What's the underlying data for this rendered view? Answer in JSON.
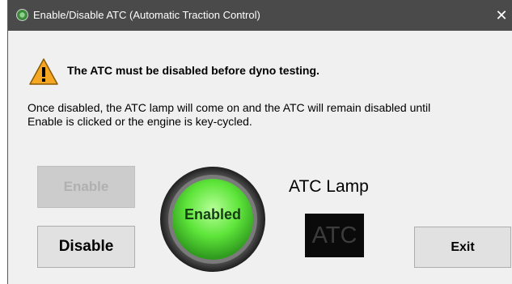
{
  "window": {
    "title": "Enable/Disable ATC  (Automatic Traction Control)",
    "icon": "app-icon",
    "close_label": "✕",
    "colors": {
      "titlebar": "#4a4a4a",
      "body": "#f0f0f0"
    }
  },
  "warning": {
    "icon": "warning-triangle-icon",
    "text": "The ATC must be disabled before dyno testing."
  },
  "description": {
    "line1": "Once disabled, the ATC lamp will come on and the ATC will remain disabled until",
    "line2": "Enable is clicked or the engine is key-cycled."
  },
  "buttons": {
    "enable_label": "Enable",
    "enable_state": "disabled",
    "disable_label": "Disable",
    "exit_label": "Exit"
  },
  "status_indicator": {
    "label": "Enabled",
    "color": "#5ee53a"
  },
  "lamp": {
    "title": "ATC Lamp",
    "text": "ATC",
    "state": "off"
  }
}
